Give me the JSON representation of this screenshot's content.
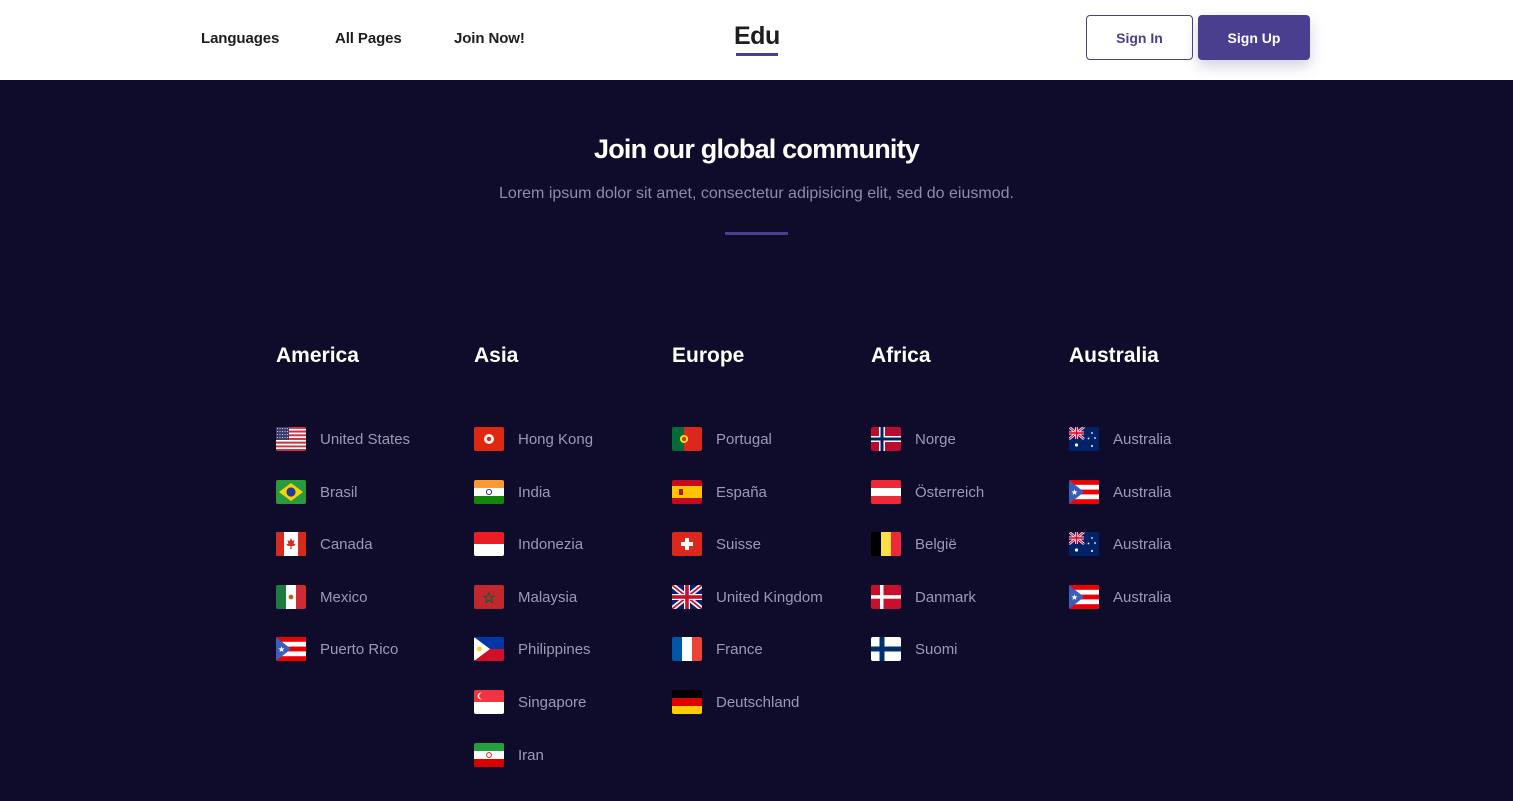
{
  "nav": {
    "links": [
      "Languages",
      "All Pages",
      "Join Now!"
    ],
    "logo": "Edu",
    "sign_in": "Sign In",
    "sign_up": "Sign Up"
  },
  "hero": {
    "title": "Join our global community",
    "subtitle": "Lorem ipsum dolor sit amet, consectetur adipisicing elit, sed do eiusmod."
  },
  "colors": {
    "background": "#0e0b2b",
    "accent": "#4a3e8e",
    "muted_text": "#9c9ab3"
  },
  "regions": [
    {
      "title": "America",
      "items": [
        {
          "label": "United States",
          "flag": "us-flag-icon"
        },
        {
          "label": "Brasil",
          "flag": "br-flag-icon"
        },
        {
          "label": "Canada",
          "flag": "ca-flag-icon"
        },
        {
          "label": "Mexico",
          "flag": "mx-flag-icon"
        },
        {
          "label": "Puerto Rico",
          "flag": "pr-flag-icon"
        }
      ]
    },
    {
      "title": "Asia",
      "items": [
        {
          "label": "Hong Kong",
          "flag": "hk-flag-icon"
        },
        {
          "label": "India",
          "flag": "in-flag-icon"
        },
        {
          "label": "Indonezia",
          "flag": "id-flag-icon"
        },
        {
          "label": "Malaysia",
          "flag": "ma-flag-icon"
        },
        {
          "label": "Philippines",
          "flag": "ph-flag-icon"
        },
        {
          "label": "Singapore",
          "flag": "sg-flag-icon"
        },
        {
          "label": "Iran",
          "flag": "ir-flag-icon"
        }
      ]
    },
    {
      "title": "Europe",
      "items": [
        {
          "label": "Portugal",
          "flag": "pt-flag-icon"
        },
        {
          "label": "España",
          "flag": "es-flag-icon"
        },
        {
          "label": "Suisse",
          "flag": "ch-flag-icon"
        },
        {
          "label": "United Kingdom",
          "flag": "gb-flag-icon"
        },
        {
          "label": "France",
          "flag": "fr-flag-icon"
        },
        {
          "label": "Deutschland",
          "flag": "de-flag-icon"
        }
      ]
    },
    {
      "title": "Africa",
      "items": [
        {
          "label": "Norge",
          "flag": "no-flag-icon"
        },
        {
          "label": "Österreich",
          "flag": "at-flag-icon"
        },
        {
          "label": "België",
          "flag": "be-flag-icon"
        },
        {
          "label": "Danmark",
          "flag": "dk-flag-icon"
        },
        {
          "label": "Suomi",
          "flag": "fi-flag-icon"
        }
      ]
    },
    {
      "title": "Australia",
      "items": [
        {
          "label": "Australia",
          "flag": "au-flag-icon"
        },
        {
          "label": "Australia",
          "flag": "pr-flag-icon"
        },
        {
          "label": "Australia",
          "flag": "au-flag-icon"
        },
        {
          "label": "Australia",
          "flag": "pr-flag-icon"
        }
      ]
    }
  ]
}
